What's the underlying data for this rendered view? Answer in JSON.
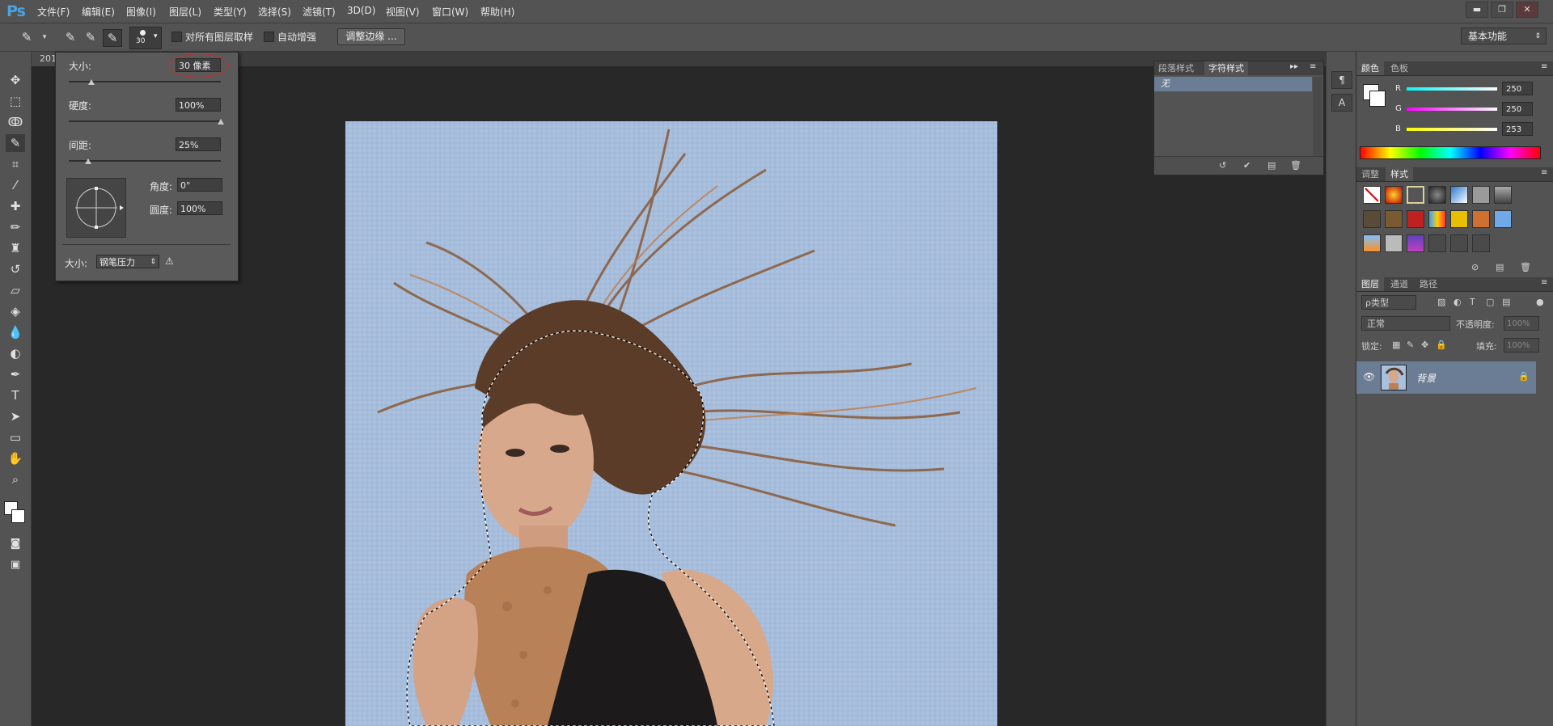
{
  "app": {
    "logo": "Ps"
  },
  "menu": [
    "文件(F)",
    "编辑(E)",
    "图像(I)",
    "图层(L)",
    "类型(Y)",
    "选择(S)",
    "滤镜(T)",
    "3D(D)",
    "视图(V)",
    "窗口(W)",
    "帮助(H)"
  ],
  "window_controls": {
    "minimize": "▬",
    "restore": "❐",
    "close": "✕"
  },
  "options": {
    "brush_size": "30",
    "sample_all_layers": "对所有图层取样",
    "auto_enhance": "自动增强",
    "refine_edge": "调整边缘 ...",
    "workspace": "基本功能"
  },
  "doc_tab": "201",
  "brush_popup": {
    "size_label": "大小:",
    "size_value": "30 像素",
    "hardness_label": "硬度:",
    "hardness_value": "100%",
    "spacing_label": "间距:",
    "spacing_value": "25%",
    "angle_label": "角度:",
    "angle_value": "0°",
    "roundness_label": "圆度:",
    "roundness_value": "100%",
    "pressure_label": "大小:",
    "pressure_value": "钢笔压力"
  },
  "style_panel": {
    "tabs": [
      "段落样式",
      "字符样式"
    ],
    "active_tab": 1,
    "item": "无"
  },
  "color_panel": {
    "tabs": [
      "颜色",
      "色板"
    ],
    "r_label": "R",
    "g_label": "G",
    "b_label": "B",
    "r": "250",
    "g": "250",
    "b": "253"
  },
  "adjust_panel": {
    "tabs": [
      "调整",
      "样式"
    ],
    "active_tab": 1
  },
  "layers_panel": {
    "tabs": [
      "图层",
      "通道",
      "路径"
    ],
    "filter": "ρ类型",
    "blend_mode": "正常",
    "opacity_label": "不透明度:",
    "opacity_value": "100%",
    "lock_label": "锁定:",
    "fill_label": "填充:",
    "fill_value": "100%",
    "layer_name": "背景"
  },
  "colors": {
    "accent": "#4aa3df",
    "selection": "#6a7d94",
    "canvas_bg": "#a9c0de"
  }
}
